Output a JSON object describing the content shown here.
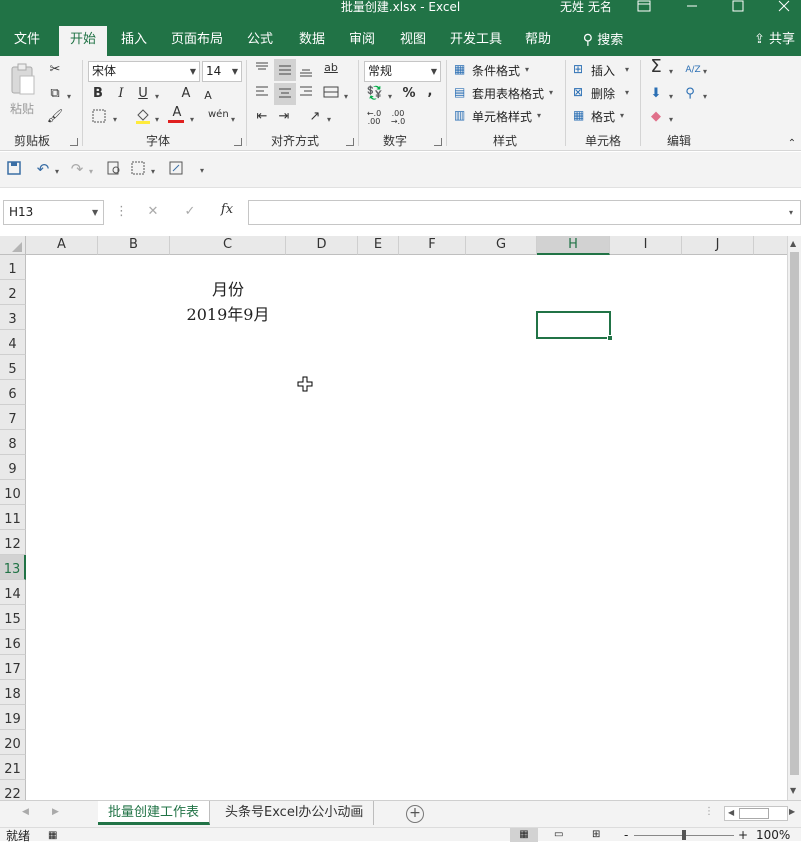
{
  "window": {
    "title": "批量创建.xlsx  -  Excel",
    "user": "无姓 无名"
  },
  "ribbon_tabs": [
    "文件",
    "开始",
    "插入",
    "页面布局",
    "公式",
    "数据",
    "审阅",
    "视图",
    "开发工具",
    "帮助"
  ],
  "search_label": "搜索",
  "share_label": "共享",
  "clipboard": {
    "paste_label": "粘贴",
    "group_label": "剪贴板"
  },
  "font": {
    "name": "宋体",
    "size": "14",
    "bold": "B",
    "italic": "I",
    "underline": "U",
    "grow": "A",
    "shrink": "A",
    "color_glyph": "A",
    "phonetic": "wén",
    "group_label": "字体"
  },
  "alignment": {
    "group_label": "对齐方式",
    "wrap": "ab"
  },
  "number": {
    "format": "常规",
    "percent": "%",
    "comma": ",",
    "inc_dec": ".00 →.0",
    "dec_dec": ".00",
    "group_label": "数字"
  },
  "styles": {
    "conditional": "条件格式",
    "table": "套用表格格式",
    "cell": "单元格样式",
    "group_label": "样式"
  },
  "cells_group": {
    "insert": "插入",
    "delete": "删除",
    "format": "格式",
    "group_label": "单元格"
  },
  "editing": {
    "group_label": "编辑",
    "sum": "Σ",
    "sort": "A/Z"
  },
  "namebox": "H13",
  "fx_label": "fx",
  "columns": [
    "A",
    "B",
    "C",
    "D",
    "E",
    "F",
    "G",
    "H",
    "I",
    "J"
  ],
  "rows": [
    "1",
    "2",
    "3",
    "4",
    "5",
    "6",
    "7",
    "8",
    "9",
    "10",
    "11",
    "12",
    "13",
    "14",
    "15",
    "16",
    "17",
    "18",
    "19",
    "20",
    "21",
    "22"
  ],
  "cells": {
    "c2": "月份",
    "c3": "2019年9月"
  },
  "sheet_tabs": [
    "批量创建工作表",
    "头条号Excel办公小动画"
  ],
  "status": {
    "ready": "就绪",
    "zoom": "100%"
  },
  "colors": {
    "accent": "#217346"
  }
}
